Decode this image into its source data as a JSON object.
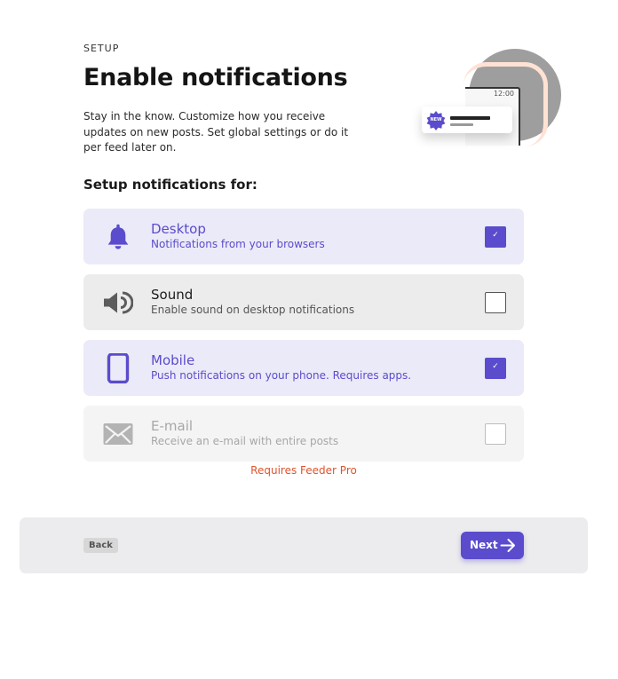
{
  "header": {
    "eyebrow": "SETUP",
    "title": "Enable notifications",
    "description": "Stay in the know. Customize how you receive updates on new posts. Set global settings or do it per feed later on."
  },
  "illustration": {
    "time": "12:00",
    "badge": "NEW"
  },
  "setup": {
    "heading": "Setup notifications for:",
    "options": [
      {
        "title": "Desktop",
        "subtitle": "Notifications from your browsers",
        "checked": true,
        "enabled": true,
        "icon": "bell-icon"
      },
      {
        "title": "Sound",
        "subtitle": "Enable sound on desktop notifications",
        "checked": false,
        "enabled": true,
        "icon": "speaker-icon"
      },
      {
        "title": "Mobile",
        "subtitle": "Push notifications on your phone. Requires apps.",
        "checked": true,
        "enabled": true,
        "icon": "phone-icon"
      },
      {
        "title": "E-mail",
        "subtitle": "Receive an e-mail with entire posts",
        "checked": false,
        "enabled": false,
        "icon": "envelope-icon"
      }
    ],
    "pro_note": "Requires Feeder Pro"
  },
  "footer": {
    "back_label": "Back",
    "next_label": "Next"
  },
  "colors": {
    "accent": "#5a4ccc",
    "checked_bg": "#ebeaf8",
    "unchecked_bg": "#ececec",
    "disabled_bg": "#f4f4f4",
    "warning": "#e0532e",
    "footer_bg": "#ececee"
  }
}
